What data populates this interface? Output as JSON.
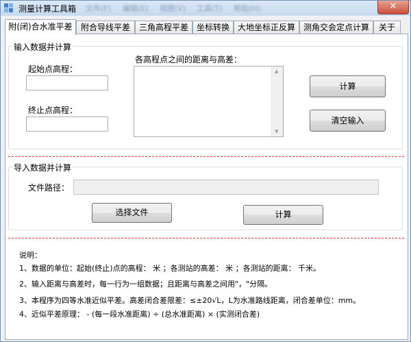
{
  "window": {
    "title": "测量计算工具箱",
    "menus": [
      "文件(F)",
      "编辑(E)",
      "视图(V)",
      "工具(T)",
      "帮助(H)"
    ],
    "close_glyph": "✕"
  },
  "tabs": [
    {
      "label": "附(闭)合水准平差",
      "active": true
    },
    {
      "label": "附合导线平差",
      "active": false
    },
    {
      "label": "三角高程平差",
      "active": false
    },
    {
      "label": "坐标转换",
      "active": false
    },
    {
      "label": "大地坐标正反算",
      "active": false
    },
    {
      "label": "测角交会定点计算",
      "active": false
    },
    {
      "label": "关于",
      "active": false
    }
  ],
  "input_group": {
    "title": "输入数据并计算",
    "start_label": "起始点高程：",
    "start_value": "",
    "end_label": "终止点高程：",
    "end_value": "",
    "data_label": "各高程点之间的距离与高差：",
    "data_value": "",
    "calc_button": "计算",
    "clear_button": "清空输入"
  },
  "import_group": {
    "title": "导入数据并计算",
    "path_label": "文件路径：",
    "path_value": "",
    "choose_button": "选择文件",
    "calc_button": "计算"
  },
  "notes": {
    "heading": "说明：",
    "lines": [
      "1、数据的单位：起始(终止)点的高程： 米 ；各测站的高差： 米 ；各测站的距离： 千米。",
      "2、输入距离与高差时，每一行为一组数据；且距离与高差之间用\"，\"分隔。",
      "3、本程序为四等水准近似平差。高差闭合差限差：≤±20√L，L为水准路线距离，闭合差单位：mm。",
      "4、近似平差原理： - (每一段水准距离) ÷ (总水准距离) × (实测闭合差)"
    ]
  },
  "colors": {
    "separator": "#e0362c",
    "titlebar": "#c6d9ef",
    "close_button": "#c9503a"
  }
}
